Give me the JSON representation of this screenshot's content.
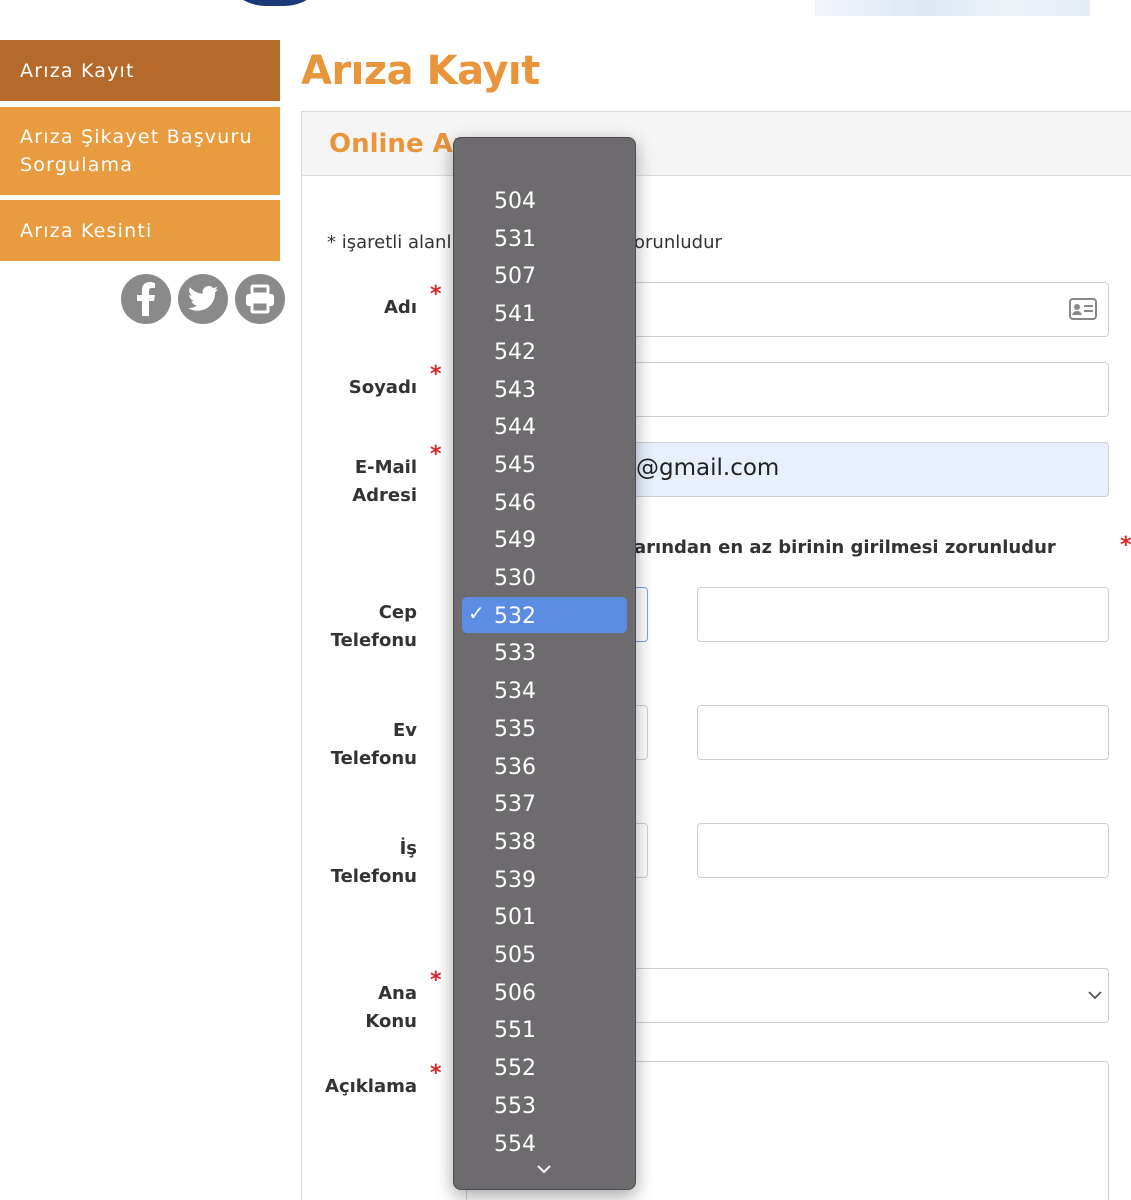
{
  "sidebar": {
    "items": [
      {
        "label": "Arıza Kayıt"
      },
      {
        "label": "Arıza Şikayet Başvuru Sorgulama"
      },
      {
        "label": "Arıza Kesinti"
      }
    ],
    "social": [
      "facebook-icon",
      "twitter-icon",
      "print-icon"
    ]
  },
  "page": {
    "title": "Arıza Kayıt"
  },
  "panel": {
    "title": "Online Arıza Bildirimi",
    "title_visible": "Online Ar",
    "required_note_left": "* işaretli alanl",
    "required_note_right": "orunludur",
    "phone_note": "arından en az birinin girilmesi zorunludur"
  },
  "form": {
    "name_label": "Adı",
    "surname_label": "Soyadı",
    "email_label_1": "E-Mail",
    "email_label_2": "Adresi",
    "email_value_visible": "@gmail.com",
    "mobile_label_1": "Cep",
    "mobile_label_2": "Telefonu",
    "home_label_1": "Ev",
    "home_label_2": "Telefonu",
    "work_label_1": "İş",
    "work_label_2": "Telefonu",
    "topic_label_1": "Ana",
    "topic_label_2": "Konu",
    "description_label": "Açıklama",
    "required_mark": "*"
  },
  "dropdown": {
    "selected": "532",
    "check": "✓",
    "options": [
      "504",
      "531",
      "507",
      "541",
      "542",
      "543",
      "544",
      "545",
      "546",
      "549",
      "530",
      "532",
      "533",
      "534",
      "535",
      "536",
      "537",
      "538",
      "539",
      "501",
      "505",
      "506",
      "551",
      "552",
      "553",
      "554"
    ]
  },
  "colors": {
    "accent": "#e9953c",
    "active_menu": "#b5692a",
    "menu": "#e99b3f",
    "required": "#d62828",
    "menu_bg": "#6e6b6f",
    "selected_option": "#5c8de3"
  }
}
